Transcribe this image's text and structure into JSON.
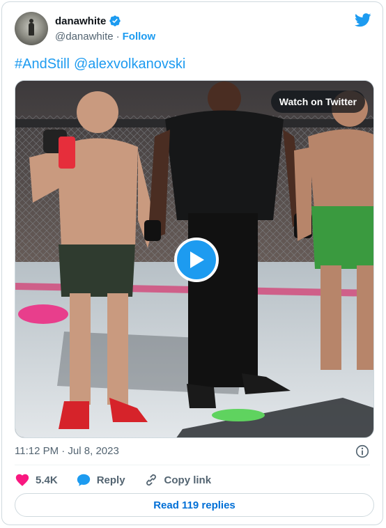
{
  "author": {
    "display_name": "danawhite",
    "handle": "@danawhite",
    "separator": "·",
    "follow_label": "Follow"
  },
  "tweet": {
    "hashtag": "#AndStill",
    "mention": "@alexvolkanovski"
  },
  "media": {
    "watch_label": "Watch on Twitter",
    "play_icon": "play-icon"
  },
  "meta": {
    "timestamp": "11:12 PM · Jul 8, 2023"
  },
  "actions": {
    "likes_count": "5.4K",
    "reply_label": "Reply",
    "copy_link_label": "Copy link",
    "read_replies_label": "Read 119 replies"
  },
  "colors": {
    "accent": "#1d9bf0",
    "like": "#f91880",
    "link": "#006fd6",
    "muted": "#536471"
  }
}
